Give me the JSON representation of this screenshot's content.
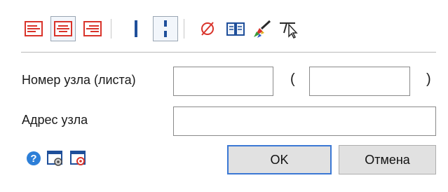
{
  "toolbar": {
    "items": [
      {
        "icon": "align-left-icon",
        "pressed": false
      },
      {
        "icon": "align-center-icon",
        "pressed": true
      },
      {
        "icon": "align-right-icon",
        "pressed": false
      },
      {
        "icon": "line-solid-icon",
        "pressed": false
      },
      {
        "icon": "line-dashed-icon",
        "pressed": true
      },
      {
        "icon": "diameter-icon",
        "pressed": false
      },
      {
        "icon": "book-icon",
        "pressed": false
      },
      {
        "icon": "paint-brush-icon",
        "pressed": false
      },
      {
        "icon": "leader-cursor-icon",
        "pressed": false
      }
    ]
  },
  "form": {
    "node_number_label": "Номер узла (листа)",
    "node_number_value": "",
    "sheet_number_value": "",
    "paren_open": "(",
    "paren_close": ")",
    "node_address_label": "Адрес узла",
    "node_address_value": ""
  },
  "buttons": {
    "ok_label": "OK",
    "cancel_label": "Отмена"
  },
  "bottom_icons": [
    "help-icon",
    "settings-icon",
    "stamp-icon"
  ],
  "colors": {
    "accent_blue": "#3b78d4",
    "icon_red": "#d9342b",
    "button_face": "#e1e1e1"
  }
}
